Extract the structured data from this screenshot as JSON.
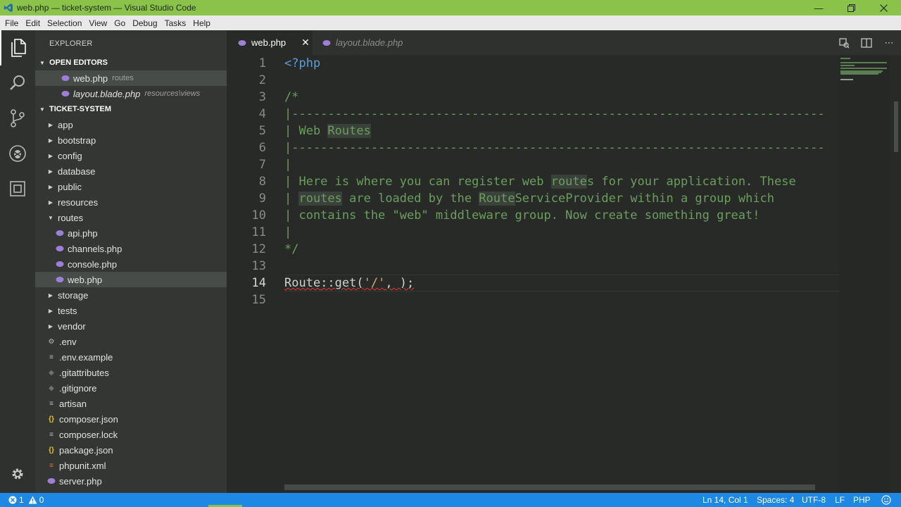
{
  "window": {
    "title": "web.php — ticket-system — Visual Studio Code"
  },
  "menu": [
    "File",
    "Edit",
    "Selection",
    "View",
    "Go",
    "Debug",
    "Tasks",
    "Help"
  ],
  "activitybar": {
    "icons": [
      "files-icon",
      "search-icon",
      "source-control-icon",
      "debug-icon",
      "extensions-icon",
      "gear-icon"
    ]
  },
  "sidebar": {
    "title": "EXPLORER",
    "open_editors": {
      "label": "OPEN EDITORS",
      "items": [
        {
          "name": "web.php",
          "desc": "routes"
        },
        {
          "name": "layout.blade.php",
          "desc": "resources\\views"
        }
      ]
    },
    "project": {
      "label": "TICKET-SYSTEM",
      "items": [
        "app",
        "bootstrap",
        "config",
        "database",
        "public",
        "resources",
        "routes",
        "api.php",
        "channels.php",
        "console.php",
        "web.php",
        "storage",
        "tests",
        "vendor",
        ".env",
        ".env.example",
        ".gitattributes",
        ".gitignore",
        "artisan",
        "composer.json",
        "composer.lock",
        "package.json",
        "phpunit.xml",
        "server.php"
      ]
    }
  },
  "tabs": [
    {
      "label": "web.php",
      "active": true
    },
    {
      "label": "layout.blade.php",
      "active": false
    }
  ],
  "editor": {
    "line_numbers": [
      "1",
      "2",
      "3",
      "4",
      "5",
      "6",
      "7",
      "8",
      "9",
      "10",
      "11",
      "12",
      "13",
      "14",
      "15"
    ],
    "code": {
      "l1": "<?php",
      "l3": "/*",
      "l4": "|--------------------------------------------------------------------------",
      "l5a": "| Web ",
      "l5b": "Routes",
      "l6": "|--------------------------------------------------------------------------",
      "l7": "|",
      "l8a": "| Here is where you can register web ",
      "l8b": "route",
      "l8c": "s for your application. These",
      "l9a": "| ",
      "l9b": "routes",
      "l9c": " are loaded by the ",
      "l9d": "Route",
      "l9e": "ServiceProvider within a group which",
      "l10": "| contains the \"web\" middleware group. Now create something great!",
      "l11": "|",
      "l12": "*/",
      "l14a": "Route",
      "l14b": "::get(",
      "l14c": "'/'",
      "l14d": ", );"
    }
  },
  "statusbar": {
    "errors": "1",
    "warnings": "0",
    "position": "Ln 14, Col 1",
    "spaces": "Spaces: 4",
    "encoding": "UTF-8",
    "eol": "LF",
    "language": "PHP"
  },
  "colors": {
    "titlebar": "#8bc34a",
    "statusbar": "#1e88e5",
    "php_icon": "#9c7fd6"
  }
}
